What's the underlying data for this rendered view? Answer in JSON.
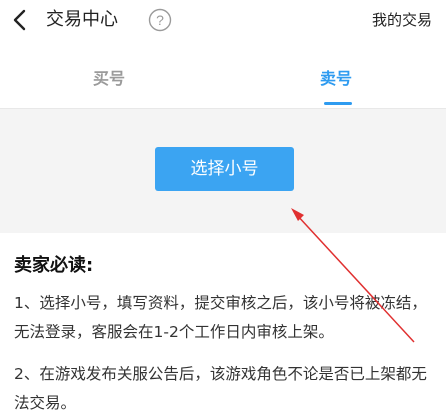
{
  "topbar": {
    "back_icon": "chevron-left-icon",
    "title": "交易中心",
    "help_icon": "question-circle-icon",
    "my_trades": "我的交易"
  },
  "tabs": [
    {
      "label": "买号",
      "active": false
    },
    {
      "label": "卖号",
      "active": true
    }
  ],
  "main": {
    "select_button": "选择小号",
    "notice_title": "卖家必读:",
    "notices": [
      "1、选择小号，填写资料，提交审核之后，该小号将被冻结，无法登录，客服会在1-2个工作日内审核上架。",
      "2、在游戏发布关服公告后，该游戏角色不论是否已上架都无法交易。"
    ]
  },
  "colors": {
    "accent": "#3ba4f2",
    "active_tab": "#2e9bf0",
    "inactive_tab": "#9a9a9a",
    "annotation_arrow": "#e03030",
    "gray_bg": "#f4f4f4"
  }
}
